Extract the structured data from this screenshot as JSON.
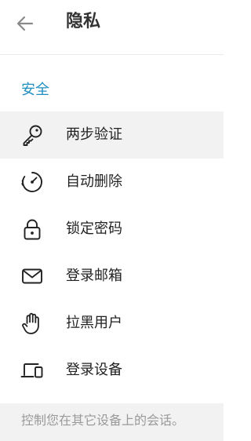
{
  "header": {
    "back_icon": "arrow-left-icon",
    "title": "隐私"
  },
  "section": {
    "title": "安全"
  },
  "menu": {
    "items": [
      {
        "label": "两步验证",
        "icon": "key-icon",
        "active": true
      },
      {
        "label": "自动删除",
        "icon": "timer-icon",
        "active": false
      },
      {
        "label": "锁定密码",
        "icon": "lock-icon",
        "active": false
      },
      {
        "label": "登录邮箱",
        "icon": "mail-icon",
        "active": false
      },
      {
        "label": "拉黑用户",
        "icon": "hand-icon",
        "active": false
      },
      {
        "label": "登录设备",
        "icon": "devices-icon",
        "active": false
      }
    ]
  },
  "footer": {
    "note": "控制您在其它设备上的会话。"
  },
  "colors": {
    "accent": "#1f8fc0",
    "active_row": "#f2f2f2",
    "footer_bg": "#f2f2f2",
    "footer_text": "#9a9a9a"
  }
}
